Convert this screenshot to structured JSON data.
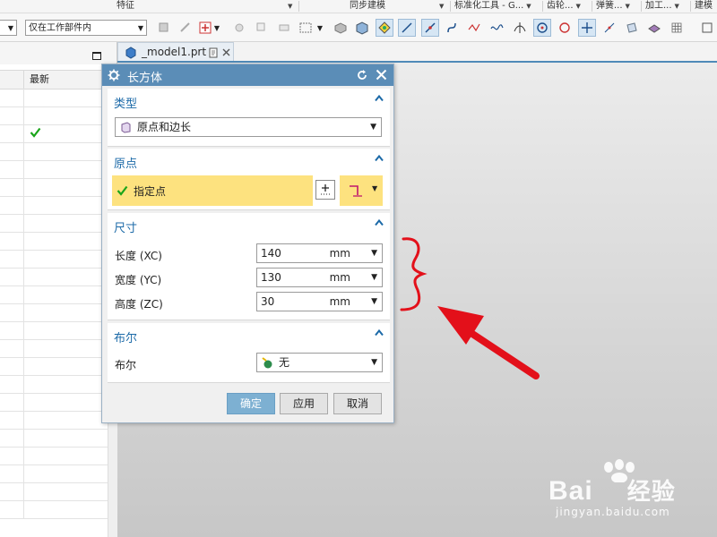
{
  "ribbon": {
    "groups": [
      "特征",
      "同步建模",
      "标准化工具 - G...",
      "齿轮...",
      "弹簧...",
      "加工...",
      "建模"
    ]
  },
  "toolbar": {
    "filter_value": "仅在工作部件内"
  },
  "navigator": {
    "column_header": "最新"
  },
  "tab": {
    "label": "_model1.prt"
  },
  "dialog": {
    "title": "长方体",
    "type_section": {
      "title": "类型",
      "value": "原点和边长"
    },
    "origin_section": {
      "title": "原点",
      "specify_point": "指定点"
    },
    "dims_section": {
      "title": "尺寸",
      "rows": [
        {
          "label": "长度 (XC)",
          "value": "140",
          "unit": "mm"
        },
        {
          "label": "宽度 (YC)",
          "value": "130",
          "unit": "mm"
        },
        {
          "label": "高度 (ZC)",
          "value": "30",
          "unit": "mm"
        }
      ]
    },
    "boolean_section": {
      "title": "布尔",
      "label": "布尔",
      "value": "无"
    },
    "buttons": {
      "ok": "确定",
      "apply": "应用",
      "cancel": "取消"
    }
  },
  "colors": {
    "title_bar": "#5b8db7",
    "section_title": "#1c6aa8",
    "highlight_row": "#fde27f",
    "annotation": "#e3101a",
    "check": "#1aa51a"
  },
  "watermark": {
    "brand": "Bai",
    "brand_tail": "经验",
    "url": "jingyan.baidu.com"
  }
}
